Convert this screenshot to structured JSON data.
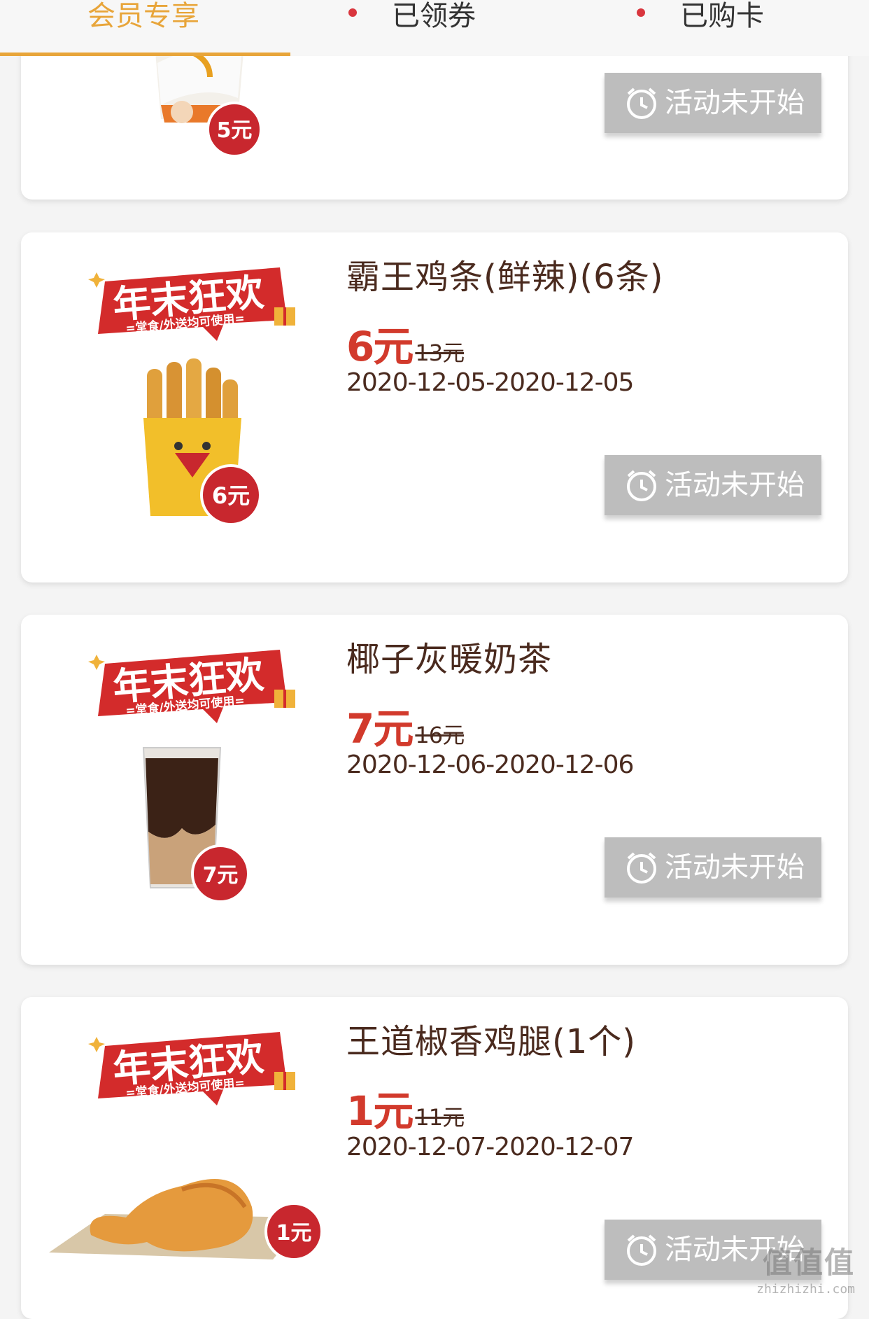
{
  "tabs": [
    {
      "label": "会员专享",
      "active": true,
      "dot": false
    },
    {
      "label": "已领券",
      "active": false,
      "dot": true
    },
    {
      "label": "已购卡",
      "active": false,
      "dot": true
    }
  ],
  "promo_badge": {
    "title": "年末狂欢",
    "subtitle": "=堂食/外送均可使用="
  },
  "products": [
    {
      "name": "",
      "price": "",
      "original_price": "",
      "dates": "",
      "button": "活动未开始",
      "sticker": "5元",
      "image": "drink-cup"
    },
    {
      "name": "霸王鸡条(鲜辣)(6条)",
      "price": "6元",
      "original_price": "13元",
      "dates": "2020-12-05-2020-12-05",
      "button": "活动未开始",
      "sticker": "6元",
      "image": "chicken-strips"
    },
    {
      "name": "椰子灰暖奶茶",
      "price": "7元",
      "original_price": "16元",
      "dates": "2020-12-06-2020-12-06",
      "button": "活动未开始",
      "sticker": "7元",
      "image": "milk-tea"
    },
    {
      "name": "王道椒香鸡腿(1个)",
      "price": "1元",
      "original_price": "11元",
      "dates": "2020-12-07-2020-12-07",
      "button": "活动未开始",
      "sticker": "1元",
      "image": "chicken-leg"
    }
  ],
  "colors": {
    "accent": "#e8a53a",
    "price": "#d23a2c",
    "button": "#bdbdbd",
    "badge": "#d9363e"
  },
  "watermark": {
    "big": "值值值",
    "small": "zhizhizhi.com"
  }
}
